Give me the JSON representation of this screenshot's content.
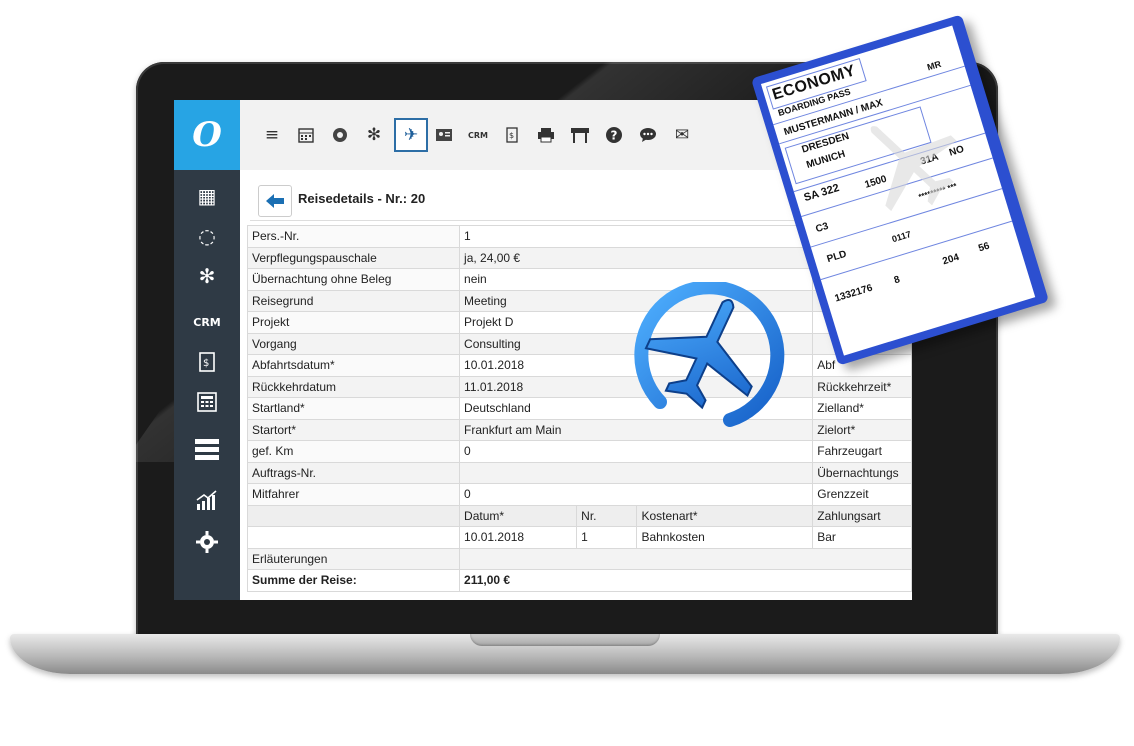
{
  "app": {
    "logo": "O",
    "page_title": "Reisedetails - Nr.: 20"
  },
  "sidebar": {
    "items": [
      {
        "icon": "calendar-icon",
        "glyph": "▦"
      },
      {
        "icon": "circle-icon",
        "glyph": "◌"
      },
      {
        "icon": "bug-icon",
        "glyph": "✻"
      },
      {
        "icon": "crm-icon",
        "label": "CRM"
      },
      {
        "icon": "invoice-icon",
        "glyph": "$"
      },
      {
        "icon": "calculator-icon",
        "glyph": "▦"
      },
      {
        "icon": "menu-icon",
        "glyph": "☰"
      },
      {
        "icon": "chart-icon",
        "glyph": "↗"
      },
      {
        "icon": "gear-icon",
        "glyph": "⚙"
      }
    ]
  },
  "toolbar": {
    "items": [
      {
        "icon": "menu-icon",
        "glyph": "≡"
      },
      {
        "icon": "calendar-icon",
        "glyph": "▦"
      },
      {
        "icon": "coin-icon",
        "glyph": "◉"
      },
      {
        "icon": "bug-icon",
        "glyph": "✻"
      },
      {
        "icon": "plane-icon",
        "glyph": "✈",
        "active": true
      },
      {
        "icon": "id-card-icon",
        "glyph": "▣"
      },
      {
        "icon": "crm-icon",
        "label": "CRM"
      },
      {
        "icon": "invoice-icon",
        "glyph": "$"
      },
      {
        "icon": "printer-icon",
        "glyph": "▬"
      },
      {
        "icon": "barrier-icon",
        "glyph": "⊓"
      },
      {
        "icon": "help-icon",
        "glyph": "?"
      },
      {
        "icon": "chat-icon",
        "glyph": "•"
      },
      {
        "icon": "mail-icon",
        "glyph": "✉"
      }
    ]
  },
  "details": {
    "rows": [
      {
        "label": "Pers.-Nr.",
        "value": "1",
        "right": ""
      },
      {
        "label": "Verpflegungspauschale",
        "value": "ja, 24,00 €",
        "right": ""
      },
      {
        "label": "Übernachtung ohne Beleg",
        "value": "nein",
        "right": ""
      },
      {
        "label": "Reisegrund",
        "value": "Meeting",
        "right": ""
      },
      {
        "label": "Projekt",
        "value": "Projekt D",
        "right": ""
      },
      {
        "label": "Vorgang",
        "value": "Consulting",
        "right": ""
      },
      {
        "label": "Abfahrtsdatum*",
        "value": "10.01.2018",
        "right": "Abf"
      },
      {
        "label": "Rückkehrdatum",
        "value": "11.01.2018",
        "right": "Rückkehrzeit*"
      },
      {
        "label": "Startland*",
        "value": "Deutschland",
        "right": "Zielland*"
      },
      {
        "label": "Startort*",
        "value": "Frankfurt am Main",
        "right": "Zielort*"
      },
      {
        "label": "gef. Km",
        "value": "0",
        "right": "Fahrzeugart"
      },
      {
        "label": "Auftrags-Nr.",
        "value": "",
        "right": "Übernachtungs"
      },
      {
        "label": "Mitfahrer",
        "value": "0",
        "right": "Grenzzeit"
      }
    ],
    "cost_header": {
      "datum": "Datum*",
      "nr": "Nr.",
      "kostenart": "Kostenart*",
      "zahlungsart": "Zahlungsart"
    },
    "cost_row": {
      "datum": "10.01.2018",
      "nr": "1",
      "kostenart": "Bahnkosten",
      "zahlungsart": "Bar"
    },
    "erlaeuterungen_label": "Erläuterungen",
    "sum_label": "Summe der Reise:",
    "sum_value": "211,00 €"
  },
  "boarding_pass": {
    "class": "ECONOMY",
    "title": "BOARDING PASS",
    "name": "MUSTERMANN / MAX",
    "salutation": "MR",
    "from": "DRESDEN",
    "to": "MUNICH",
    "flight": "SA 322",
    "boarding_time": "1500",
    "seat": "31A",
    "smoking": "NO",
    "gate": "C3",
    "info": "*********  ***",
    "pcs": "PLD",
    "additional": "0117",
    "document_number": "1332176",
    "num_8": "8",
    "num_204": "204",
    "num_56": "56",
    "colors": {
      "border": "#2c4fd0"
    }
  },
  "colors": {
    "accent": "#27a4e4",
    "sidebar": "#2f3a45",
    "plane": "#2e8fe8"
  }
}
